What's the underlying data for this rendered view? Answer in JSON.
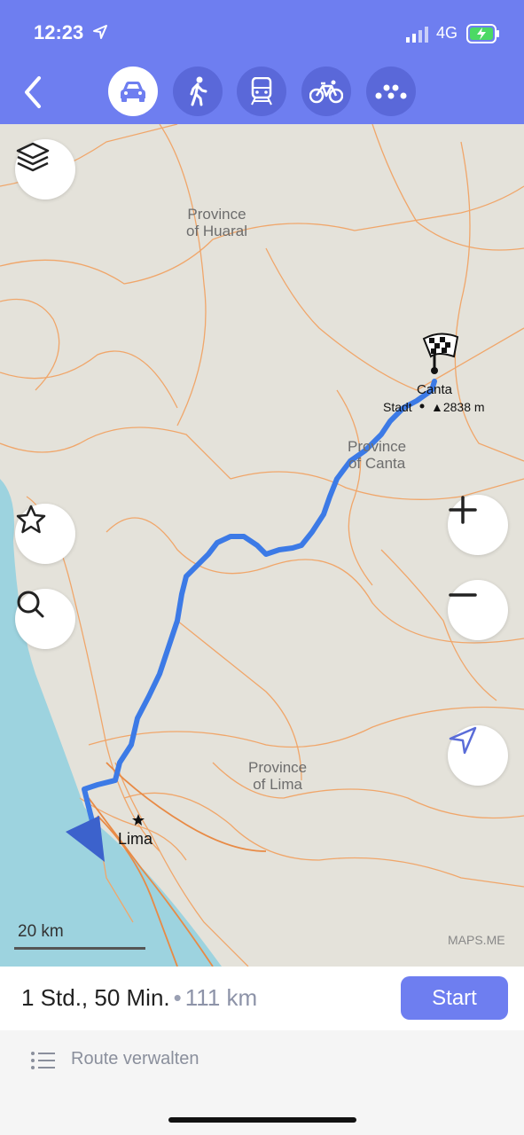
{
  "status": {
    "time": "12:23",
    "network": "4G"
  },
  "modes": [
    {
      "name": "car",
      "icon": "car-icon",
      "active": true
    },
    {
      "name": "walk",
      "icon": "pedestrian-icon",
      "active": false
    },
    {
      "name": "transit",
      "icon": "train-icon",
      "active": false
    },
    {
      "name": "bike",
      "icon": "bicycle-icon",
      "active": false
    },
    {
      "name": "ruler",
      "icon": "ruler-dots-icon",
      "active": false
    }
  ],
  "map": {
    "labels": {
      "huaral": "Province\nof Huaral",
      "canta_province": "Province\nof Canta",
      "lima_province": "Province\nof Lima",
      "canta": "Canta",
      "stadt": "Stadt",
      "elevation": "▲2838 m",
      "lima": "Lima"
    },
    "scale": "20 km",
    "attribution": "MAPS.ME",
    "colors": {
      "route": "#3c7ae6",
      "water": "#9dd3df",
      "land": "#e4e2da",
      "roads": "#f0a66a"
    }
  },
  "route": {
    "duration": "1 Std., 50 Min.",
    "separator": "•",
    "distance": "111 km",
    "start_label": "Start",
    "manage_label": "Route verwalten"
  }
}
